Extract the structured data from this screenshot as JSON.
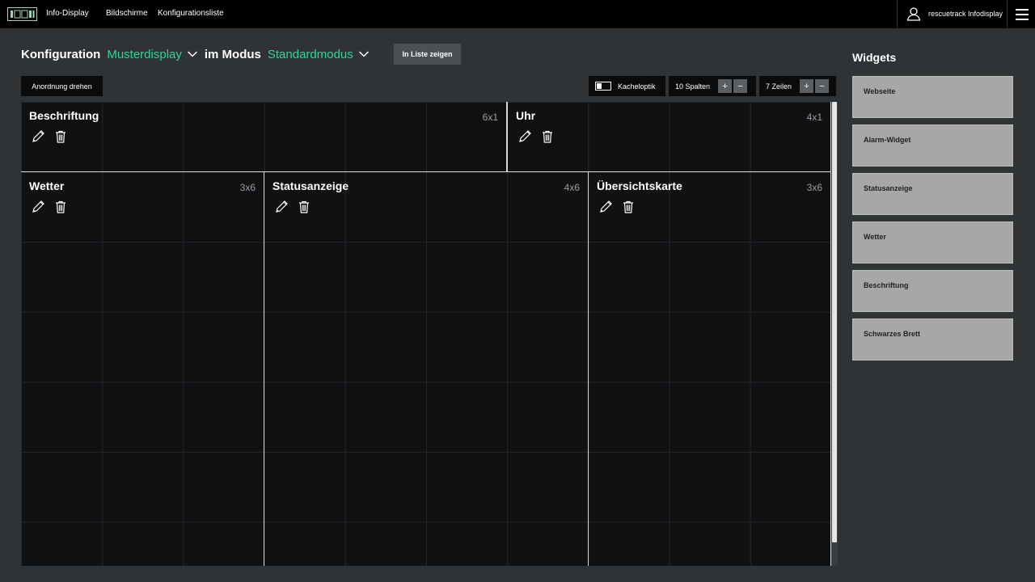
{
  "nav": {
    "items": [
      "Info-Display",
      "Bildschirme",
      "Konfigurationsliste"
    ],
    "user": "rescuetrack Infodisplay"
  },
  "header": {
    "label_config": "Konfiguration",
    "display": "Musterdisplay",
    "label_mode": "im Modus",
    "mode": "Standardmodus",
    "list_button": "In Liste zeigen"
  },
  "toolbar": {
    "rotate": "Anordnung drehen",
    "tile_look": "Kacheloptik",
    "columns": "10 Spalten",
    "rows": "7 Zeilen",
    "plus": "+",
    "minus": "−"
  },
  "tiles": [
    {
      "title": "Beschriftung",
      "size": "6x1"
    },
    {
      "title": "Uhr",
      "size": "4x1"
    },
    {
      "title": "Wetter",
      "size": "3x6"
    },
    {
      "title": "Statusanzeige",
      "size": "4x6"
    },
    {
      "title": "Übersichtskarte",
      "size": "3x6"
    }
  ],
  "widgets": {
    "title": "Widgets",
    "items": [
      "Webseite",
      "Alarm-Widget",
      "Statusanzeige",
      "Wetter",
      "Beschriftung",
      "Schwarzes Brett"
    ]
  },
  "colors": {
    "accent": "#34d399",
    "panel": "#2f3336",
    "grid": "#101113",
    "card": "#a7a8a6"
  }
}
